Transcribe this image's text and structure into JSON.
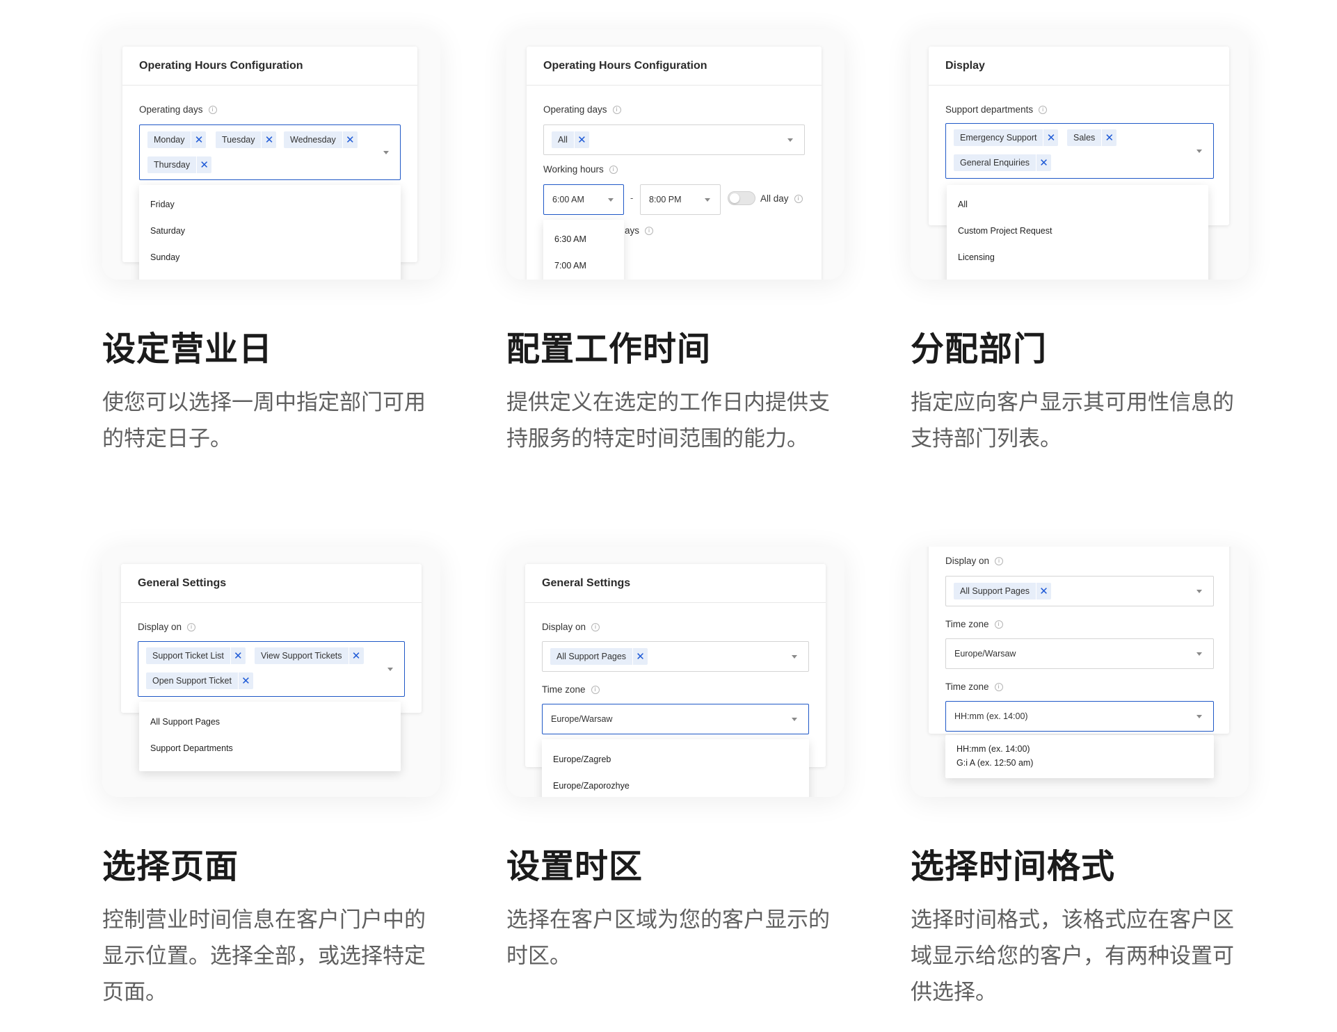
{
  "card1": {
    "panel_title": "Operating Hours Configuration",
    "field_label": "Operating days",
    "tags": [
      "Monday",
      "Tuesday",
      "Wednesday",
      "Thursday"
    ],
    "options": [
      "Friday",
      "Saturday",
      "Sunday"
    ],
    "title": "设定营业日",
    "desc": "使您可以选择一周中指定部门可用的特定日子。"
  },
  "card2": {
    "panel_title": "Operating Hours Configuration",
    "days_label": "Operating days",
    "days_tag": "All",
    "hours_label": "Working hours",
    "from_time": "6:00 AM",
    "separator": "-",
    "to_time": "8:00 PM",
    "allday_label": "All day",
    "hidden_label_fragment": "ays",
    "options": [
      "6:30 AM",
      "7:00 AM"
    ],
    "title": "配置工作时间",
    "desc": "提供定义在选定的工作日内提供支持服务的特定时间范围的能力。"
  },
  "card3": {
    "panel_title": "Display",
    "field_label": "Support departments",
    "tags": [
      "Emergency Support",
      "Sales",
      "General Enquiries"
    ],
    "options": [
      "All",
      "Custom Project Request",
      "Licensing"
    ],
    "title": "分配部门",
    "desc": "指定应向客户显示其可用性信息的支持部门列表。"
  },
  "card4": {
    "panel_title": "General Settings",
    "field_label": "Display on",
    "tags": [
      "Support Ticket List",
      "View Support Tickets",
      "Open Support Ticket"
    ],
    "options": [
      "All Support Pages",
      "Support Departments"
    ],
    "title": "选择页面",
    "desc": "控制营业时间信息在客户门户中的显示位置。选择全部，或选择特定页面。"
  },
  "card5": {
    "panel_title": "General Settings",
    "display_label": "Display on",
    "display_tag": "All Support Pages",
    "tz_label": "Time zone",
    "tz_value": "Europe/Warsaw",
    "options": [
      "Europe/Zagreb",
      "Europe/Zaporozhye"
    ],
    "title": "设置时区",
    "desc": "选择在客户区域为您的客户显示的时区。"
  },
  "card6": {
    "display_label": "Display on",
    "display_tag": "All Support Pages",
    "tz_label": "Time zone",
    "tz_value": "Europe/Warsaw",
    "fmt_label": "Time zone",
    "fmt_value": "HH:mm (ex. 14:00)",
    "options": [
      "HH:mm (ex. 14:00)",
      "G:i A (ex. 12:50 am)"
    ],
    "title": "选择时间格式",
    "desc": "选择时间格式，该格式应在客户区域显示给您的客户，有两种设置可供选择。"
  },
  "colors": {
    "accent": "#1f58c7",
    "tag_bg": "#e7eef9",
    "tag_x": "#1d59d6"
  },
  "icons": {
    "info": "info-circle-icon",
    "remove": "close-icon",
    "caret": "chevron-down-icon"
  }
}
